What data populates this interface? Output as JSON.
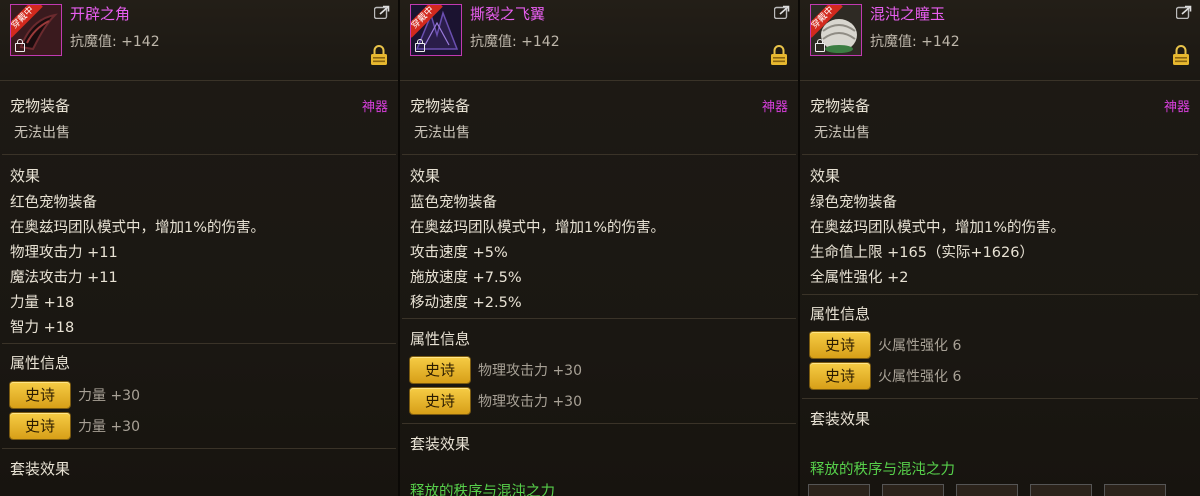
{
  "panels": [
    {
      "ribbon": "穿戴中",
      "name": "开辟之角",
      "resist": "抗魔值: +142",
      "category": "宠物装备",
      "grade": "神器",
      "sell": "无法出售",
      "effect_title": "效果",
      "effects": [
        "红色宠物装备",
        "在奥兹玛团队模式中，增加1%的伤害。",
        "物理攻击力 +11",
        "魔法攻击力 +11",
        "力量 +18",
        "智力 +18"
      ],
      "attr_title": "属性信息",
      "attrs": [
        {
          "label": "史诗",
          "value": "力量 +30"
        },
        {
          "label": "史诗",
          "value": "力量 +30"
        }
      ],
      "set_title": "套装效果",
      "set_name": ""
    },
    {
      "ribbon": "穿戴中",
      "name": "撕裂之飞翼",
      "resist": "抗魔值: +142",
      "category": "宠物装备",
      "grade": "神器",
      "sell": "无法出售",
      "effect_title": "效果",
      "effects": [
        "蓝色宠物装备",
        "在奥兹玛团队模式中，增加1%的伤害。",
        "攻击速度 +5%",
        "施放速度 +7.5%",
        "移动速度 +2.5%"
      ],
      "attr_title": "属性信息",
      "attrs": [
        {
          "label": "史诗",
          "value": "物理攻击力 +30"
        },
        {
          "label": "史诗",
          "value": "物理攻击力 +30"
        }
      ],
      "set_title": "套装效果",
      "set_name": "释放的秩序与混沌之力"
    },
    {
      "ribbon": "穿戴中",
      "name": "混沌之瞳玉",
      "resist": "抗魔值: +142",
      "category": "宠物装备",
      "grade": "神器",
      "sell": "无法出售",
      "effect_title": "效果",
      "effects": [
        "绿色宠物装备",
        "在奥兹玛团队模式中，增加1%的伤害。",
        "生命值上限 +165（实际+1626）",
        "全属性强化 +2"
      ],
      "attr_title": "属性信息",
      "attrs": [
        {
          "label": "史诗",
          "value": "火属性强化 6"
        },
        {
          "label": "史诗",
          "value": "火属性强化 6"
        }
      ],
      "set_title": "套装效果",
      "set_name": "释放的秩序与混沌之力"
    }
  ],
  "colors": {
    "name": "#e85ef0",
    "grade": "#d83fdd",
    "set_name": "#57d04b",
    "epic_button": "#f0c23a"
  },
  "icons": [
    "share-icon",
    "lock-icon",
    "horn-item-icon",
    "wing-item-icon",
    "orb-item-icon"
  ]
}
